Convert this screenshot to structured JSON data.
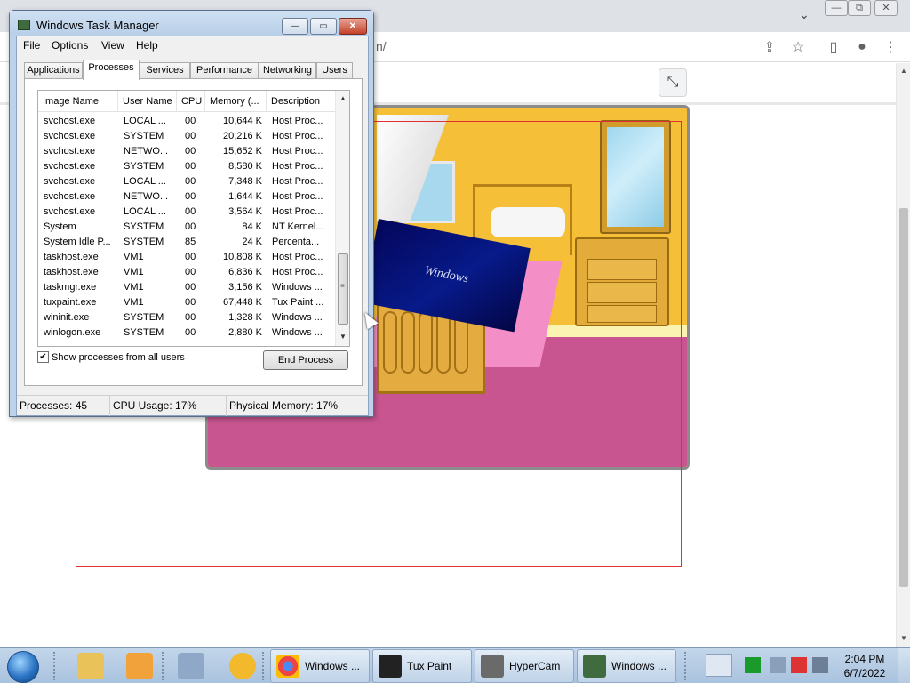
{
  "browser": {
    "url_fragment": "n/",
    "win_controls": {
      "minimize": "—",
      "maximize": "⧉",
      "close": "✕"
    },
    "tab_search": "⌄",
    "toolbar_icons": {
      "share": "⇪",
      "bookmark": "☆",
      "side_panel": "▯",
      "profile": "●",
      "menu": "⋮"
    },
    "exit_fullscreen": "⤡"
  },
  "canvas": {
    "splash_logo": "Windows"
  },
  "task_manager": {
    "title": "Windows Task Manager",
    "caption_buttons": {
      "minimize": "—",
      "maximize": "▭",
      "close": "✕"
    },
    "menu": [
      "File",
      "Options",
      "View",
      "Help"
    ],
    "tabs": [
      "Applications",
      "Processes",
      "Services",
      "Performance",
      "Networking",
      "Users"
    ],
    "active_tab": "Processes",
    "columns": [
      "Image Name",
      "User Name",
      "CPU",
      "Memory (...",
      "Description"
    ],
    "processes": [
      {
        "image": "svchost.exe",
        "user": "LOCAL ...",
        "cpu": "00",
        "mem": "10,644 K",
        "desc": "Host Proc..."
      },
      {
        "image": "svchost.exe",
        "user": "SYSTEM",
        "cpu": "00",
        "mem": "20,216 K",
        "desc": "Host Proc..."
      },
      {
        "image": "svchost.exe",
        "user": "NETWO...",
        "cpu": "00",
        "mem": "15,652 K",
        "desc": "Host Proc..."
      },
      {
        "image": "svchost.exe",
        "user": "SYSTEM",
        "cpu": "00",
        "mem": "8,580 K",
        "desc": "Host Proc..."
      },
      {
        "image": "svchost.exe",
        "user": "LOCAL ...",
        "cpu": "00",
        "mem": "7,348 K",
        "desc": "Host Proc..."
      },
      {
        "image": "svchost.exe",
        "user": "NETWO...",
        "cpu": "00",
        "mem": "1,644 K",
        "desc": "Host Proc..."
      },
      {
        "image": "svchost.exe",
        "user": "LOCAL ...",
        "cpu": "00",
        "mem": "3,564 K",
        "desc": "Host Proc..."
      },
      {
        "image": "System",
        "user": "SYSTEM",
        "cpu": "00",
        "mem": "84 K",
        "desc": "NT Kernel..."
      },
      {
        "image": "System Idle P...",
        "user": "SYSTEM",
        "cpu": "85",
        "mem": "24 K",
        "desc": "Percenta..."
      },
      {
        "image": "taskhost.exe",
        "user": "VM1",
        "cpu": "00",
        "mem": "10,808 K",
        "desc": "Host Proc..."
      },
      {
        "image": "taskhost.exe",
        "user": "VM1",
        "cpu": "00",
        "mem": "6,836 K",
        "desc": "Host Proc..."
      },
      {
        "image": "taskmgr.exe",
        "user": "VM1",
        "cpu": "00",
        "mem": "3,156 K",
        "desc": "Windows ..."
      },
      {
        "image": "tuxpaint.exe",
        "user": "VM1",
        "cpu": "00",
        "mem": "67,448 K",
        "desc": "Tux Paint ..."
      },
      {
        "image": "wininit.exe",
        "user": "SYSTEM",
        "cpu": "00",
        "mem": "1,328 K",
        "desc": "Windows ..."
      },
      {
        "image": "winlogon.exe",
        "user": "SYSTEM",
        "cpu": "00",
        "mem": "2,880 K",
        "desc": "Windows ..."
      }
    ],
    "show_all_label": "Show processes from all users",
    "show_all_checked": "✔",
    "end_process_label": "End Process",
    "status": {
      "processes": "Processes: 45",
      "cpu": "CPU Usage: 17%",
      "memory": "Physical Memory: 17%"
    }
  },
  "taskbar": {
    "pinned_icons": [
      "folder-icon",
      "media-player-icon",
      "keyboard-icon",
      "security-icon"
    ],
    "buttons": [
      {
        "label": "Windows ...",
        "icon": "chrome-icon"
      },
      {
        "label": "Tux Paint",
        "icon": "tux-icon"
      },
      {
        "label": "HyperCam",
        "icon": "camera-icon"
      },
      {
        "label": "Windows ...",
        "icon": "task-manager-icon"
      }
    ],
    "clock_time": "2:04 PM",
    "clock_date": "6/7/2022"
  },
  "colors": {
    "canvas_wall": "#f6bf38",
    "canvas_floor": "#c8558f",
    "selection_rect": "#e03030",
    "taskbar": "#b7cde4"
  }
}
